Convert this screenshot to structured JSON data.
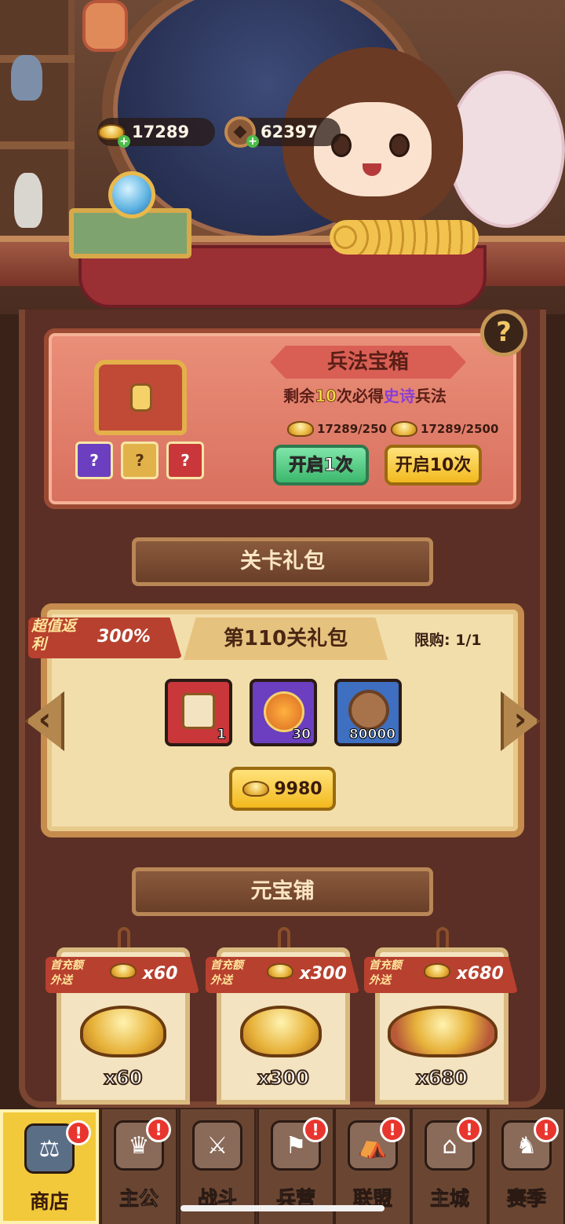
{
  "currency": {
    "ingots": "17289",
    "coins": "62397",
    "ingot_icon": "gold-ingot-icon",
    "coin_icon": "copper-coin-icon"
  },
  "treasure": {
    "title": "兵法宝箱",
    "tip_prefix": "剩余",
    "tip_count": "10",
    "tip_mid": "次必得",
    "tip_quality": "史诗",
    "tip_suffix": "兵法",
    "cost_single": "17289/250",
    "cost_ten": "17289/2500",
    "open_one_label": "开启1次",
    "open_ten_label": "开启10次",
    "mini_items": [
      "?",
      "?",
      "?"
    ],
    "help": "?"
  },
  "stage_gift": {
    "section_title": "关卡礼包",
    "badge_label": "超值返利",
    "badge_pct": "300%",
    "title": "第110关礼包",
    "limit": "限购: 1/1",
    "items": [
      {
        "icon": "general-chest-icon",
        "qty": "1"
      },
      {
        "icon": "phoenix-token-icon",
        "qty": "30"
      },
      {
        "icon": "copper-coin-icon",
        "qty": "80000"
      }
    ],
    "price": "9980",
    "prev_arrow": "‹",
    "next_arrow": "›"
  },
  "ingot_shop": {
    "section_title": "元宝铺",
    "first_label": "首充额外送",
    "cards": [
      {
        "bonus": "x60",
        "qty": "x60"
      },
      {
        "bonus": "x300",
        "qty": "x300"
      },
      {
        "bonus": "x680",
        "qty": "x680"
      }
    ]
  },
  "nav": {
    "tabs": [
      {
        "label": "商店",
        "icon": "shop-stall-icon",
        "active": true
      },
      {
        "label": "主公",
        "icon": "lord-icon",
        "active": false
      },
      {
        "label": "战斗",
        "icon": "crossed-swords-icon",
        "active": false
      },
      {
        "label": "兵营",
        "icon": "barracks-flag-icon",
        "active": false
      },
      {
        "label": "联盟",
        "icon": "alliance-tent-icon",
        "active": false
      },
      {
        "label": "主城",
        "icon": "city-map-icon",
        "active": false
      },
      {
        "label": "赛季",
        "icon": "season-dragon-icon",
        "active": false
      }
    ],
    "badge": "!"
  },
  "colors": {
    "accent_gold": "#f2c93a",
    "panel_red": "#d8705e",
    "epic_purple": "#8a3ed6",
    "button_green": "#3cb76c"
  }
}
